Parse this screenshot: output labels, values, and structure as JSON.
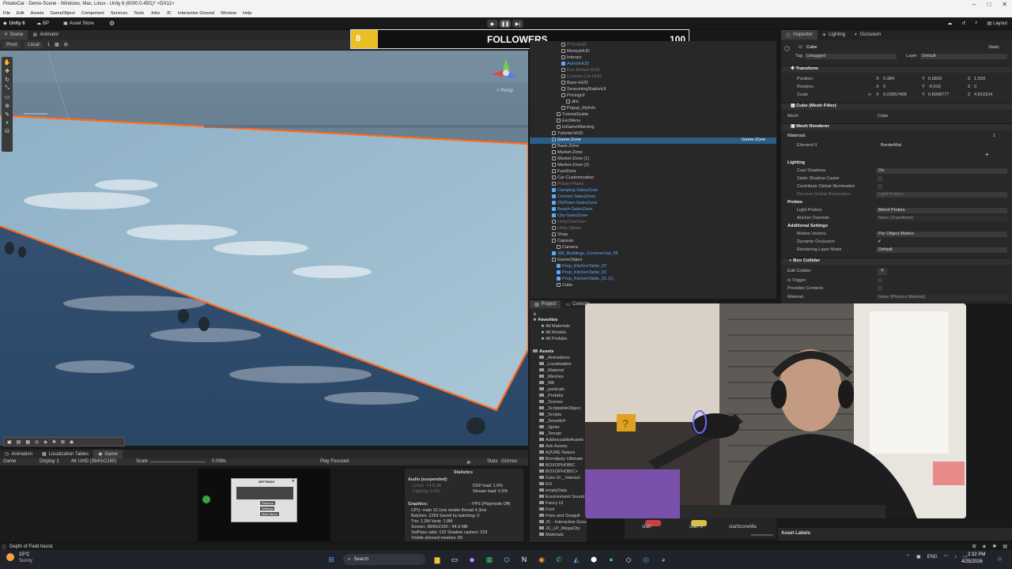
{
  "window": {
    "title": "PotatoCar - Demo-Scene - Windows, Mac, Linux - Unity 6 (6000.0.45f1)* <DX11>"
  },
  "menu": [
    "File",
    "Edit",
    "Assets",
    "GameObject",
    "Component",
    "Services",
    "Tools",
    "Jobs",
    "JC",
    "Interactive Ground",
    "Window",
    "Help"
  ],
  "toolbar": {
    "unity_label": "Unity 6",
    "bp_label": "BP",
    "asset_store_label": "Asset Store",
    "layout_label": "Layout"
  },
  "scene_tabs": [
    "Scene",
    "Animator"
  ],
  "scene_tools": {
    "pivot": "Pivot",
    "local": "Local",
    "count": "1",
    "persp": "< Persp"
  },
  "followers": {
    "count": "8",
    "label": "FOLLOWERS",
    "goal": "100",
    "progress": 0.08
  },
  "hierarchy": {
    "rows": [
      {
        "text": "TTS-HUD",
        "depth": 3,
        "style": "dim"
      },
      {
        "text": "MoneyHUD",
        "depth": 3,
        "style": "normal"
      },
      {
        "text": "Interact",
        "depth": 3,
        "style": "normal"
      },
      {
        "text": "AdminHUD",
        "depth": 3,
        "style": "blue"
      },
      {
        "text": "Fun-Refuel-HUD",
        "depth": 3,
        "style": "dim"
      },
      {
        "text": "Custom-Car-HUD",
        "depth": 3,
        "style": "dim"
      },
      {
        "text": "Base-HUD",
        "depth": 3,
        "style": "normal"
      },
      {
        "text": "SeasoningStationUI",
        "depth": 3,
        "style": "normal"
      },
      {
        "text": "PricingUI",
        "depth": 3,
        "style": "normal"
      },
      {
        "text": "dlm",
        "depth": 4,
        "style": "normal"
      },
      {
        "text": "Popup_MyInfo",
        "depth": 3,
        "style": "normal"
      },
      {
        "text": "TutorialGuide",
        "depth": 2,
        "style": "normal"
      },
      {
        "text": "EscMenu",
        "depth": 2,
        "style": "normal"
      },
      {
        "text": "InGameWarning",
        "depth": 2,
        "style": "normal"
      },
      {
        "text": "Tutorial-HUD",
        "depth": 1,
        "style": "normal"
      },
      {
        "text": "Game-Zone",
        "depth": 1,
        "style": "sel",
        "right": "Game-Zone"
      },
      {
        "text": "Base-Zone",
        "depth": 1,
        "style": "normal"
      },
      {
        "text": "Market-Zone",
        "depth": 1,
        "style": "normal"
      },
      {
        "text": "Market-Zone (1)",
        "depth": 1,
        "style": "normal"
      },
      {
        "text": "Market-Zone (2)",
        "depth": 1,
        "style": "normal"
      },
      {
        "text": "FuelZone",
        "depth": 1,
        "style": "normal"
      },
      {
        "text": "Car-Customization",
        "depth": 1,
        "style": "normal"
      },
      {
        "text": "Potato-Plants",
        "depth": 1,
        "style": "dim"
      },
      {
        "text": "Camping-SalesZone",
        "depth": 1,
        "style": "blue"
      },
      {
        "text": "Concert-SalesZone",
        "depth": 1,
        "style": "blue"
      },
      {
        "text": "OldTown-SalesZone",
        "depth": 1,
        "style": "blue"
      },
      {
        "text": "Beach-SalesZone",
        "depth": 1,
        "style": "blue"
      },
      {
        "text": "City-SalesZone",
        "depth": 1,
        "style": "blue"
      },
      {
        "text": "UnityCineCam",
        "depth": 1,
        "style": "dim"
      },
      {
        "text": "Unity Spline",
        "depth": 1,
        "style": "dim"
      },
      {
        "text": "Shop",
        "depth": 1,
        "style": "normal"
      },
      {
        "text": "Capsule",
        "depth": 1,
        "style": "normal"
      },
      {
        "text": "Camera",
        "depth": 2,
        "style": "normal"
      },
      {
        "text": "SM_Buildings_Commercial_08",
        "depth": 1,
        "style": "blue"
      },
      {
        "text": "GameObject",
        "depth": 1,
        "style": "normal"
      },
      {
        "text": "Prop_KitchenTable_07",
        "depth": 2,
        "style": "blue"
      },
      {
        "text": "Prop_KitchenTable_01",
        "depth": 2,
        "style": "blue"
      },
      {
        "text": "Prop_KitchenTable_01 (1)",
        "depth": 2,
        "style": "blue"
      },
      {
        "text": "Cube",
        "depth": 2,
        "style": "normal"
      }
    ]
  },
  "inspector": {
    "tabs": [
      "Inspector",
      "Lighting",
      "Occlusion"
    ],
    "object_name": "Cube",
    "static_label": "Static",
    "tag_label": "Tag",
    "tag_value": "Untagged",
    "layer_label": "Layer",
    "layer_value": "Default",
    "transform": {
      "title": "Transform",
      "position": {
        "label": "Position",
        "x": "0.384",
        "y": "0.5833",
        "z": "1.593"
      },
      "rotation": {
        "label": "Rotation",
        "x": "0",
        "y": "-0.016",
        "z": "0"
      },
      "scale": {
        "label": "Scale",
        "x": "0.03057408",
        "y": "0.8008777",
        "z": "4.810104"
      }
    },
    "mesh_filter": {
      "title": "Cube (Mesh Filter)",
      "mesh_label": "Mesh",
      "mesh_value": "Cube"
    },
    "mesh_renderer": {
      "title": "Mesh Renderer",
      "materials_label": "Materials",
      "materials_count": "1",
      "element_label": "Element 0",
      "element_value": "BorderMat"
    },
    "lighting": {
      "title": "Lighting",
      "cast_shadows_label": "Cast Shadows",
      "cast_shadows_value": "On",
      "static_shadow_label": "Static Shadow Caster",
      "gi_label": "Contribute Global Illumination",
      "receive_gi_label": "Receive Global Illumination",
      "receive_gi_value": "Light Probes"
    },
    "probes": {
      "title": "Probes",
      "light_probes_label": "Light Probes",
      "light_probes_value": "Blend Probes",
      "anchor_label": "Anchor Override",
      "anchor_value": "None (Transform)"
    },
    "additional": {
      "title": "Additional Settings",
      "motion_label": "Motion Vectors",
      "motion_value": "Per Object Motion",
      "occlusion_label": "Dynamic Occlusion",
      "rendering_label": "Rendering Layer Mask",
      "rendering_value": "Default"
    },
    "box_collider": {
      "title": "Box Collider",
      "edit_label": "Edit Collider",
      "trigger_label": "Is Trigger",
      "contacts_label": "Provides Contacts",
      "material_label": "Material",
      "material_value": "None (Physics Material)"
    }
  },
  "project": {
    "tabs": [
      "Project",
      "Console"
    ],
    "favorites_label": "Favorites",
    "favorites": [
      "All Materials",
      "All Models",
      "All Prefabs"
    ],
    "assets_label": "Assets",
    "folders": [
      "_Animations",
      "_Localization",
      "_Material",
      "_Meshes",
      "_MK",
      "_particals",
      "_Prefabs",
      "_Scenes",
      "_ScriptableObject",
      "_Scripts",
      "_Sounds#",
      "_Sprite",
      "_Terrain",
      "AddressableAssets",
      "Ash Assets",
      "AZURE Nature",
      "Brendpoly Ultimate",
      "BOXOPHOBIC",
      "BOXOPHOBIC+",
      "Cute UI _ Interact",
      "EO",
      "emptyData",
      "Environment Sound",
      "Fancy UI",
      "Font",
      "Fries and Seagull",
      "JC - Interactive Ground",
      "JC_LP_MegaCity",
      "Materials"
    ]
  },
  "asset_strip": [
    "start",
    "start 1",
    "startIconeMa"
  ],
  "asset_labels": "Asset Labels",
  "game_tabs": [
    "Animation",
    "Localization Tables",
    "Game"
  ],
  "game_bar": {
    "mode": "Game",
    "display": "Display 1",
    "resolution": "4K UHD (3840x2160)",
    "scale_label": "Scale",
    "scale_value": "0.098x",
    "play_focused": "Play Focused",
    "stats": "Stats",
    "gizmos": "Gizmos"
  },
  "statistics": {
    "title": "Statistics",
    "audio_label": "Audio (suspended):",
    "level": "Level: -74.8 dB",
    "clipping": "Clipping: 0.0%",
    "dsp": "DSP load: 1.0%",
    "stream": "Stream load: 0.0%",
    "graphics_label": "Graphics:",
    "fps": "- FPS (Playmode Off)",
    "cpu": "CPU: main 10.1ms  render thread 4.3ms",
    "batches": "Batches: 2293  Saved by batching: 0",
    "tris": "Tris: 1.2M  Verts: 1.8M",
    "screen": "Screen: 3840x2160 - 94.9 MB",
    "setpass": "SetPass calls: 132   Shadow casters: 318",
    "skinned": "Visible skinned meshes: 65"
  },
  "game_menu": {
    "title": "SETTINGS",
    "items": [
      "Resume",
      "Settings",
      "Main Menu"
    ]
  },
  "status": {
    "message": "Depth of Field found."
  },
  "taskbar": {
    "weather_temp": "15°C",
    "weather_desc": "Sunny",
    "search": "Search",
    "lang": "ENG",
    "time": "2:32 PM",
    "date": "4/25/2026"
  },
  "colors": {
    "accent_blue": "#5aa9ff",
    "followers_fill": "#e8c026",
    "selection": "#2c5d87",
    "border_orange": "#ff6a1a"
  }
}
